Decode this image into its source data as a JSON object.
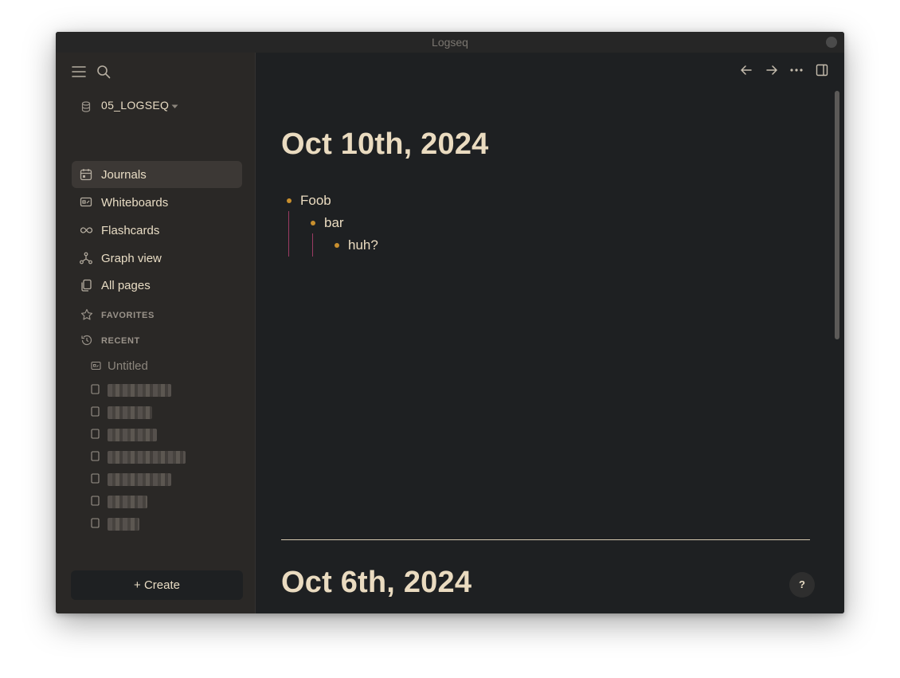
{
  "window": {
    "title": "Logseq"
  },
  "sidebar": {
    "workspace": "05_LOGSEQ",
    "nav": [
      {
        "label": "Journals",
        "icon": "calendar-icon",
        "active": true
      },
      {
        "label": "Whiteboards",
        "icon": "whiteboard-icon"
      },
      {
        "label": "Flashcards",
        "icon": "infinity-icon"
      },
      {
        "label": "Graph view",
        "icon": "graph-icon"
      },
      {
        "label": "All pages",
        "icon": "pages-icon"
      }
    ],
    "favorites_label": "FAVORITES",
    "recent_label": "RECENT",
    "recent_items": [
      {
        "label": "Untitled",
        "icon": "whiteboard-icon"
      },
      {
        "label": "",
        "icon": "page-icon",
        "blurred": true
      },
      {
        "label": "",
        "icon": "page-icon",
        "blurred": true
      },
      {
        "label": "",
        "icon": "page-icon",
        "blurred": true
      },
      {
        "label": "",
        "icon": "page-icon",
        "blurred": true
      },
      {
        "label": "",
        "icon": "page-icon",
        "blurred": true
      },
      {
        "label": "",
        "icon": "page-icon",
        "blurred": true
      },
      {
        "label": "",
        "icon": "page-icon",
        "blurred": true
      }
    ],
    "create_label": "+ Create"
  },
  "main": {
    "journals": [
      {
        "title": "Oct 10th, 2024",
        "blocks": [
          {
            "text": "Foob",
            "children": [
              {
                "text": "bar",
                "children": [
                  {
                    "text": "huh?"
                  }
                ]
              }
            ]
          }
        ]
      },
      {
        "title": "Oct 6th, 2024"
      }
    ],
    "help_label": "?"
  },
  "colors": {
    "accent": "#c98f2e",
    "thread": "#9a3b63",
    "text": "#eadbc0",
    "background": "#1e2022",
    "sidebar": "#2a2826"
  }
}
